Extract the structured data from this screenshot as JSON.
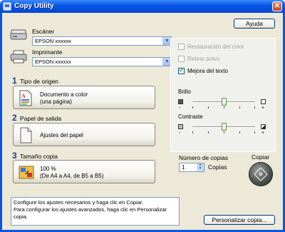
{
  "window": {
    "title": "Copy Utility",
    "close_glyph": "✕"
  },
  "help_button": "Ayuda",
  "scanner": {
    "label": "Escáner",
    "value": "EPSON xxxxxx"
  },
  "printer": {
    "label": "Imprimante",
    "value": "EPSON xxxxxx"
  },
  "steps": [
    {
      "number": "1",
      "title": "Tipo de origen",
      "value_line1": "Documento a color",
      "value_line2": "(una página)"
    },
    {
      "number": "2",
      "title": "Papel de salida",
      "value_line1": "Ajustes del papel"
    },
    {
      "number": "3",
      "title": "Tamaño copia",
      "value_line1": "100 %",
      "value_line2": "(De A4 a A4, de B5 a B5)"
    }
  ],
  "options": {
    "restore_color": {
      "label": "Restauración del color",
      "checked": false,
      "enabled": false
    },
    "remove_dust": {
      "label": "Retirar polvo",
      "checked": false,
      "enabled": false
    },
    "text_enhance": {
      "label": "Mejora del texto",
      "checked": true,
      "enabled": true
    }
  },
  "brightness": {
    "label": "Brillo",
    "level": 0.5,
    "minus": "-",
    "plus": "+"
  },
  "contrast": {
    "label": "Contraste",
    "level": 0.5,
    "minus": "-",
    "plus": "+"
  },
  "copies": {
    "label": "Número de copias",
    "value": "1",
    "unit": "Copias"
  },
  "copy_button": "Copiar",
  "info_text_1": "Configure los ajustes necesarios y haga clic en Copiar.",
  "info_text_2": "Para configurar los ajustes avanzados, haga clic en Personalizar copia.",
  "customize_button": "Personalizar copia...",
  "icons": [
    "scanner-icon",
    "printer-icon",
    "document-icon",
    "paper-icon",
    "copy-size-icon",
    "copy-start-icon"
  ]
}
